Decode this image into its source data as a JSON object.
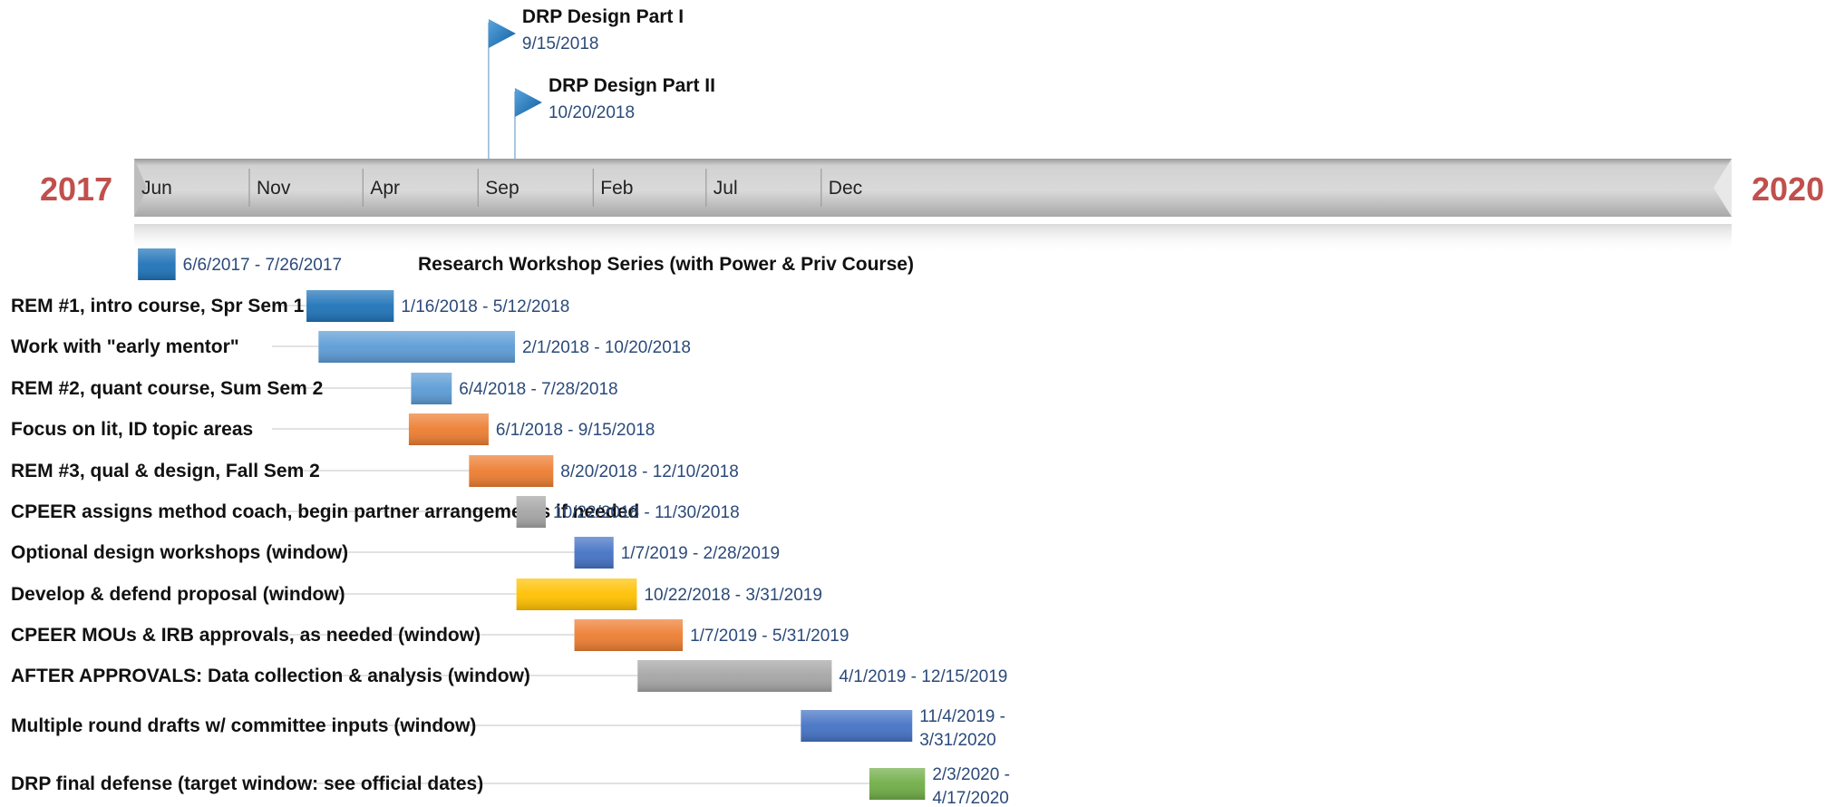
{
  "chart_data": {
    "type": "gantt",
    "start_year_label": "2017",
    "end_year_label": "2020",
    "axis_range": [
      "2017-06-01",
      "2020-05-01"
    ],
    "months": [
      "Jun",
      "Nov",
      "Apr",
      "Sep",
      "Feb",
      "Jul",
      "Dec"
    ],
    "milestones": [
      {
        "title": "DRP Design Part I",
        "date_label": "9/15/2018",
        "date": "2018-09-15",
        "level": 1
      },
      {
        "title": "DRP Design Part II",
        "date_label": "10/20/2018",
        "date": "2018-10-20",
        "level": 2
      }
    ],
    "tasks": [
      {
        "label": "Research Workshop Series (with Power & Priv Course)",
        "label_position": "right",
        "date_label": [
          "6/6/2017 - 7/26/2017"
        ],
        "start": "2017-06-06",
        "end": "2017-07-26",
        "color": "#1f73b8"
      },
      {
        "label": "REM #1, intro course, Spr Sem 1",
        "date_label": [
          "1/16/2018 - 5/12/2018"
        ],
        "start": "2018-01-16",
        "end": "2018-05-12",
        "color": "#1f73b8"
      },
      {
        "label": "Work with \"early mentor\"",
        "date_label": [
          "2/1/2018 - 10/20/2018"
        ],
        "start": "2018-02-01",
        "end": "2018-10-20",
        "color": "#5b9bd5"
      },
      {
        "label": "REM #2, quant course, Sum Sem 2",
        "date_label": [
          "6/4/2018 - 7/28/2018"
        ],
        "start": "2018-06-04",
        "end": "2018-07-28",
        "color": "#5b9bd5"
      },
      {
        "label": "Focus on lit, ID topic areas",
        "date_label": [
          "6/1/2018 - 9/15/2018"
        ],
        "start": "2018-06-01",
        "end": "2018-09-15",
        "color": "#ed7d31"
      },
      {
        "label": "REM #3, qual & design, Fall Sem 2",
        "date_label": [
          "8/20/2018 - 12/10/2018"
        ],
        "start": "2018-08-20",
        "end": "2018-12-10",
        "color": "#ed7d31"
      },
      {
        "label": "CPEER assigns method coach, begin partner arrangements if needed",
        "date_label": [
          "10/22/2018 - 11/30/2018"
        ],
        "start": "2018-10-22",
        "end": "2018-11-30",
        "color": "#a5a5a5"
      },
      {
        "label": "Optional design workshops (window)",
        "date_label": [
          "1/7/2019 - 2/28/2019"
        ],
        "start": "2019-01-07",
        "end": "2019-02-28",
        "color": "#4472c4"
      },
      {
        "label": "Develop & defend proposal (window)",
        "date_label": [
          "10/22/2018 - 3/31/2019"
        ],
        "start": "2018-10-22",
        "end": "2019-03-31",
        "color": "#ffc000"
      },
      {
        "label": "CPEER MOUs & IRB approvals, as needed (window)",
        "date_label": [
          "1/7/2019 - 5/31/2019"
        ],
        "start": "2019-01-07",
        "end": "2019-05-31",
        "color": "#ed7d31"
      },
      {
        "label": "AFTER APPROVALS:  Data collection & analysis (window)",
        "date_label": [
          "4/1/2019 - 12/15/2019"
        ],
        "start": "2019-04-01",
        "end": "2019-12-15",
        "color": "#a5a5a5"
      },
      {
        "label": "Multiple round drafts w/ committee inputs (window)",
        "date_label": [
          "11/4/2019 -",
          "3/31/2020"
        ],
        "start": "2019-11-04",
        "end": "2020-03-31",
        "color": "#4472c4"
      },
      {
        "label": "DRP final defense (target window: see official dates)",
        "date_label": [
          "2/3/2020 -",
          "4/17/2020"
        ],
        "start": "2020-02-03",
        "end": "2020-04-17",
        "color": "#70ad47"
      }
    ]
  }
}
